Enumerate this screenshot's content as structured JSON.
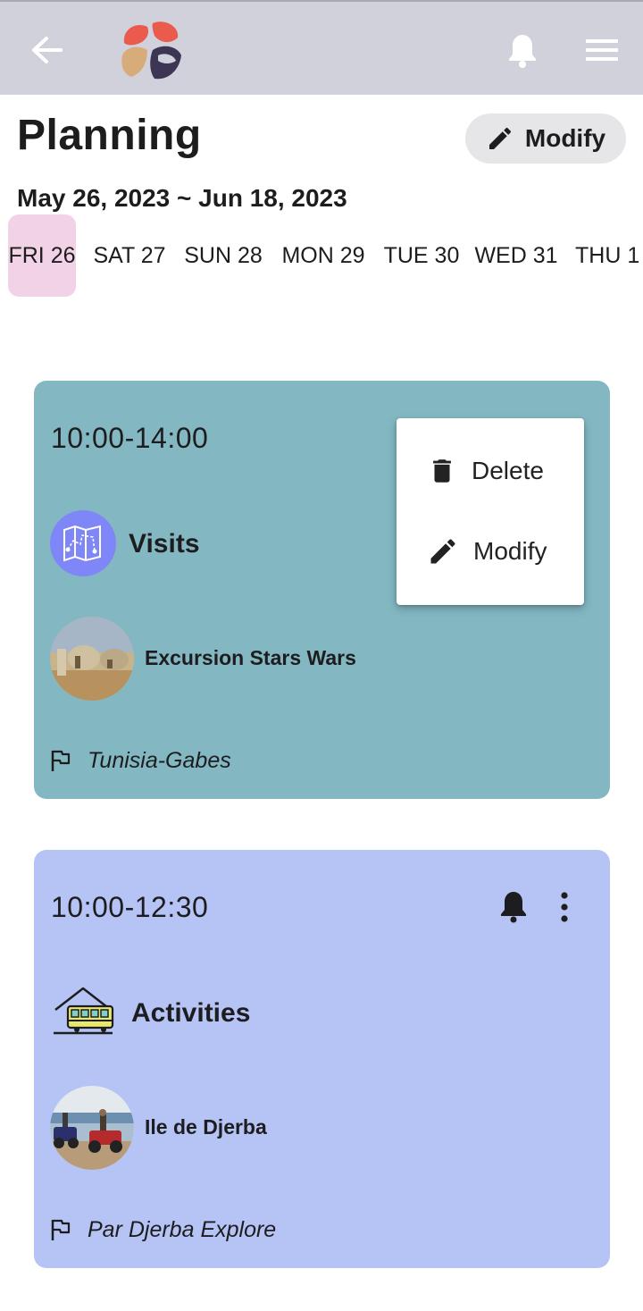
{
  "header": {
    "back_icon": "arrow-left-icon",
    "logo": "app-logo",
    "notification_icon": "bell-icon",
    "menu_icon": "hamburger-menu-icon"
  },
  "page": {
    "title": "Planning",
    "modify_label": "Modify",
    "date_range": "May 26, 2023 ~ Jun 18, 2023"
  },
  "days": [
    "FRI 26",
    "SAT 27",
    "SUN 28",
    "MON 29",
    "TUE 30",
    "WED 31",
    "THU 1"
  ],
  "selected_day": "FRI 26",
  "colors": {
    "card1": "#83b8c3",
    "card2": "#b5c4f5",
    "selected_day": "#f2d2e6",
    "visits_icon": "#7f86f8"
  },
  "events": [
    {
      "time": "10:00-14:00",
      "category": "Visits",
      "item": "Excursion Stars Wars",
      "location": "Tunisia-Gabes"
    },
    {
      "time": "10:00-12:30",
      "category": "Activities",
      "item": "Ile de Djerba",
      "location": "Par Djerba Explore"
    }
  ],
  "context_menu": {
    "delete_label": "Delete",
    "modify_label": "Modify"
  }
}
